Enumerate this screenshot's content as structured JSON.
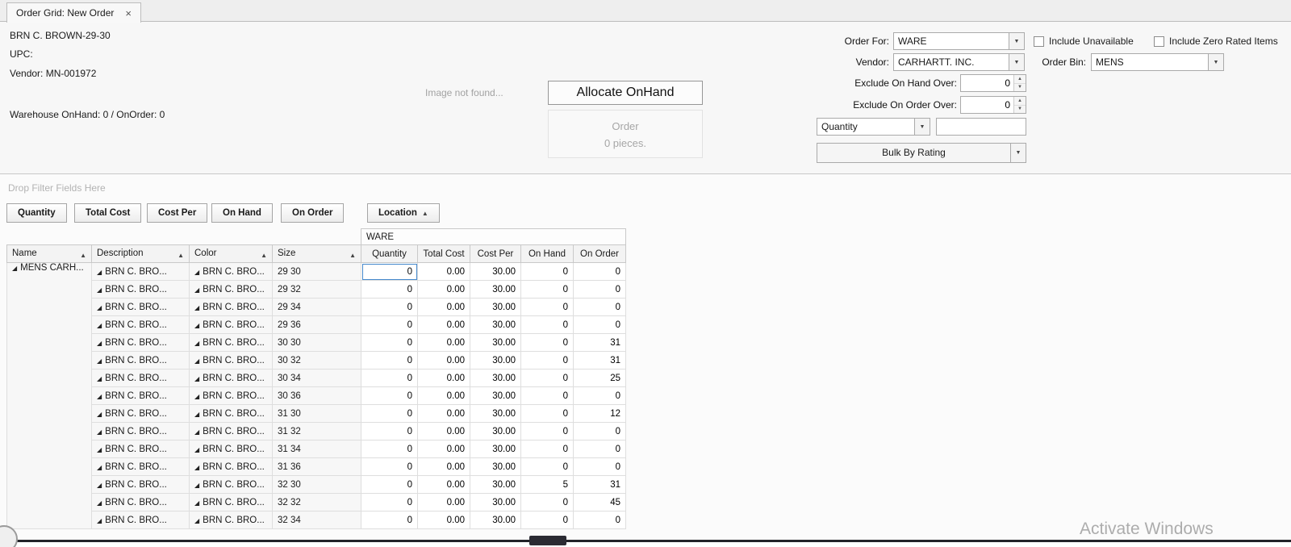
{
  "tab": {
    "title": "Order Grid: New Order",
    "close_glyph": "×"
  },
  "product": {
    "name": "BRN C. BROWN-29-30",
    "upc_label": "UPC:",
    "vendor_line": "Vendor: MN-001972",
    "warehouse_line": "Warehouse OnHand: 0 / OnOrder: 0"
  },
  "center": {
    "image_placeholder": "Image not found...",
    "allocate_button_label": "Allocate OnHand",
    "order_summary_line1": "Order",
    "order_summary_line2": "0 pieces."
  },
  "form": {
    "order_for_label": "Order For:",
    "order_for_value": "WARE",
    "include_unavailable_label": "Include Unavailable",
    "include_zero_rated_label": "Include Zero Rated Items",
    "vendor_label": "Vendor:",
    "vendor_value": "CARHARTT. INC.",
    "order_bin_label": "Order Bin:",
    "order_bin_value": "MENS",
    "exclude_on_hand_label": "Exclude On Hand Over:",
    "exclude_on_hand_value": "0",
    "exclude_on_order_label": "Exclude On Order Over:",
    "exclude_on_order_value": "0",
    "quantity_combo_value": "Quantity",
    "quantity_input_value": "",
    "bulk_by_rating_label": "Bulk By Rating",
    "dropdown_glyph": "▼",
    "spin_up_glyph": "▲",
    "spin_down_glyph": "▼"
  },
  "filter_area": {
    "placeholder": "Drop Filter Fields Here"
  },
  "fields": {
    "data_fields": [
      "Quantity",
      "Total Cost",
      "Cost Per",
      "On Hand",
      "On Order"
    ],
    "column_field": "Location",
    "sort_glyph": "▲"
  },
  "grid": {
    "group_header": "WARE",
    "row_area_headers": [
      "Name",
      "Description",
      "Color",
      "Size"
    ],
    "data_headers": [
      "Quantity",
      "Total Cost",
      "Cost Per",
      "On Hand",
      "On Order"
    ],
    "name_value": "MENS CARH...",
    "description_value": "BRN C. BRO...",
    "color_value": "BRN C. BRO...",
    "expand_glyph": "◢",
    "sort_glyph": "▲",
    "rows": [
      {
        "size": "29 30",
        "quantity": "0",
        "total_cost": "0.00",
        "cost_per": "30.00",
        "on_hand": "0",
        "on_order": "0"
      },
      {
        "size": "29 32",
        "quantity": "0",
        "total_cost": "0.00",
        "cost_per": "30.00",
        "on_hand": "0",
        "on_order": "0"
      },
      {
        "size": "29 34",
        "quantity": "0",
        "total_cost": "0.00",
        "cost_per": "30.00",
        "on_hand": "0",
        "on_order": "0"
      },
      {
        "size": "29 36",
        "quantity": "0",
        "total_cost": "0.00",
        "cost_per": "30.00",
        "on_hand": "0",
        "on_order": "0"
      },
      {
        "size": "30 30",
        "quantity": "0",
        "total_cost": "0.00",
        "cost_per": "30.00",
        "on_hand": "0",
        "on_order": "31"
      },
      {
        "size": "30 32",
        "quantity": "0",
        "total_cost": "0.00",
        "cost_per": "30.00",
        "on_hand": "0",
        "on_order": "31"
      },
      {
        "size": "30 34",
        "quantity": "0",
        "total_cost": "0.00",
        "cost_per": "30.00",
        "on_hand": "0",
        "on_order": "25"
      },
      {
        "size": "30 36",
        "quantity": "0",
        "total_cost": "0.00",
        "cost_per": "30.00",
        "on_hand": "0",
        "on_order": "0"
      },
      {
        "size": "31 30",
        "quantity": "0",
        "total_cost": "0.00",
        "cost_per": "30.00",
        "on_hand": "0",
        "on_order": "12"
      },
      {
        "size": "31 32",
        "quantity": "0",
        "total_cost": "0.00",
        "cost_per": "30.00",
        "on_hand": "0",
        "on_order": "0"
      },
      {
        "size": "31 34",
        "quantity": "0",
        "total_cost": "0.00",
        "cost_per": "30.00",
        "on_hand": "0",
        "on_order": "0"
      },
      {
        "size": "31 36",
        "quantity": "0",
        "total_cost": "0.00",
        "cost_per": "30.00",
        "on_hand": "0",
        "on_order": "0"
      },
      {
        "size": "32 30",
        "quantity": "0",
        "total_cost": "0.00",
        "cost_per": "30.00",
        "on_hand": "5",
        "on_order": "31"
      },
      {
        "size": "32 32",
        "quantity": "0",
        "total_cost": "0.00",
        "cost_per": "30.00",
        "on_hand": "0",
        "on_order": "45"
      },
      {
        "size": "32 34",
        "quantity": "0",
        "total_cost": "0.00",
        "cost_per": "30.00",
        "on_hand": "0",
        "on_order": "0"
      }
    ]
  },
  "watermark": "Activate Windows"
}
